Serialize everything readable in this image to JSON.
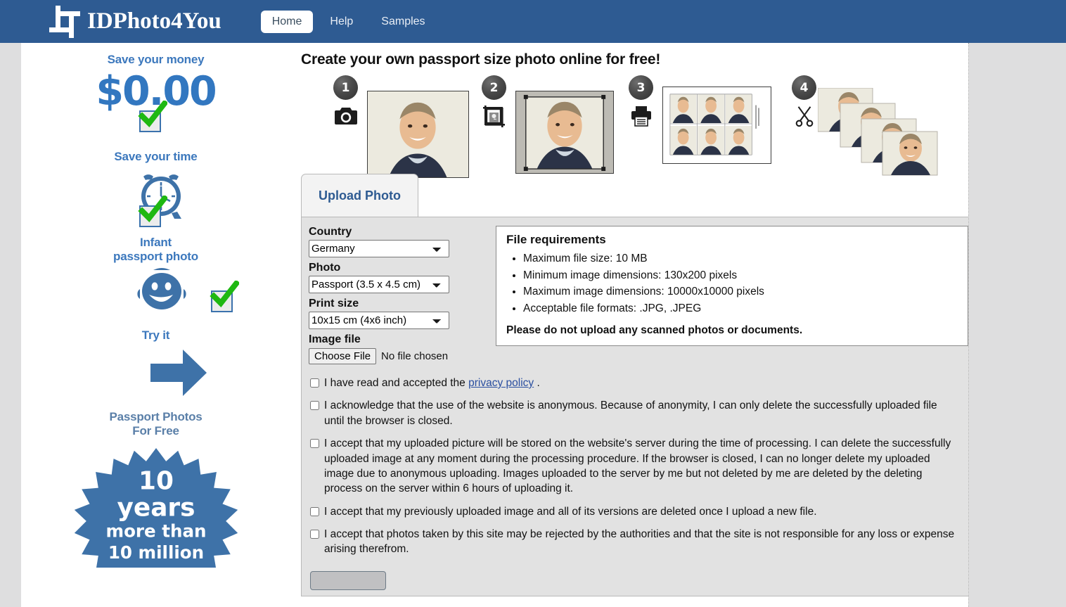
{
  "navbar": {
    "brand": "IDPhoto4You",
    "logo_icon": "crop-tool-icon",
    "links": [
      {
        "label": "Home",
        "active": true
      },
      {
        "label": "Help",
        "active": false
      },
      {
        "label": "Samples",
        "active": false
      }
    ]
  },
  "sidebar": {
    "blocks": [
      {
        "caption": "Save your money",
        "value": "$0.00",
        "icon": "dollar-amount",
        "checked": true
      },
      {
        "caption": "Save your time",
        "icon": "alarm-clock-icon",
        "checked": true
      },
      {
        "caption": "Infant\npassport photo",
        "caption_line1": "Infant",
        "caption_line2": "passport photo",
        "icon": "baby-face-icon",
        "checked": true
      },
      {
        "caption": "Try it",
        "icon": "right-arrow-icon",
        "checked": false
      }
    ],
    "footer_line1": "Passport Photos",
    "footer_line2": "For Free",
    "badge": {
      "line1": "10",
      "line2": "years",
      "line3": "more than",
      "line4": "10 million"
    }
  },
  "main": {
    "title": "Create your own passport size photo online for free!",
    "steps": [
      {
        "number": "1",
        "icon": "camera-icon"
      },
      {
        "number": "2",
        "icon": "crop-photo-icon"
      },
      {
        "number": "3",
        "icon": "printer-icon"
      },
      {
        "number": "4",
        "icon": "scissors-icon"
      }
    ],
    "tabs": [
      {
        "label": "Upload Photo",
        "active": true
      }
    ],
    "form": {
      "country_label": "Country",
      "country_value": "Germany",
      "country_options": [
        "Germany"
      ],
      "photo_label": "Photo",
      "photo_value": "Passport (3.5 x 4.5 cm)",
      "photo_options": [
        "Passport (3.5 x 4.5 cm)"
      ],
      "print_label": "Print size",
      "print_value": "10x15 cm (4x6 inch)",
      "print_options": [
        "10x15 cm (4x6 inch)"
      ],
      "file_label": "Image file",
      "choose_file_button": "Choose File",
      "no_file_text": "No file chosen"
    },
    "requirements": {
      "title": "File requirements",
      "items": [
        "Maximum file size: 10 MB",
        "Minimum image dimensions: 130x200 pixels",
        "Maximum image dimensions: 10000x10000 pixels",
        "Acceptable file formats: .JPG, .JPEG"
      ],
      "note": "Please do not upload any scanned photos or documents."
    },
    "consents": [
      {
        "pre": "I have read and accepted the ",
        "link": "privacy policy",
        "post": " .",
        "checked": false
      },
      {
        "text": "I acknowledge that the use of the website is anonymous. Because of anonymity, I can only delete the successfully uploaded file until the browser is closed.",
        "checked": false
      },
      {
        "text": "I accept that my uploaded picture will be stored on the website's server during the time of processing. I can delete the successfully uploaded image at any moment during the processing procedure. If the browser is closed, I can no longer delete my uploaded image due to anonymous uploading. Images uploaded to the server by me but not deleted by me are deleted by the deleting process on the server within 6 hours of uploading it.",
        "checked": false
      },
      {
        "text": "I accept that my previously uploaded image and all of its versions are deleted once I upload a new file.",
        "checked": false
      },
      {
        "text": "I accept that photos taken by this site may be rejected by the authorities and that the site is not responsible for any loss or expense arising therefrom.",
        "checked": false
      }
    ],
    "submit_label": ""
  },
  "colors": {
    "navbar": "#2e5b92",
    "accent_blue": "#3277c0",
    "check_green": "#1fb812",
    "panel_bg": "#e2e2e2",
    "page_bg": "#dededf"
  }
}
